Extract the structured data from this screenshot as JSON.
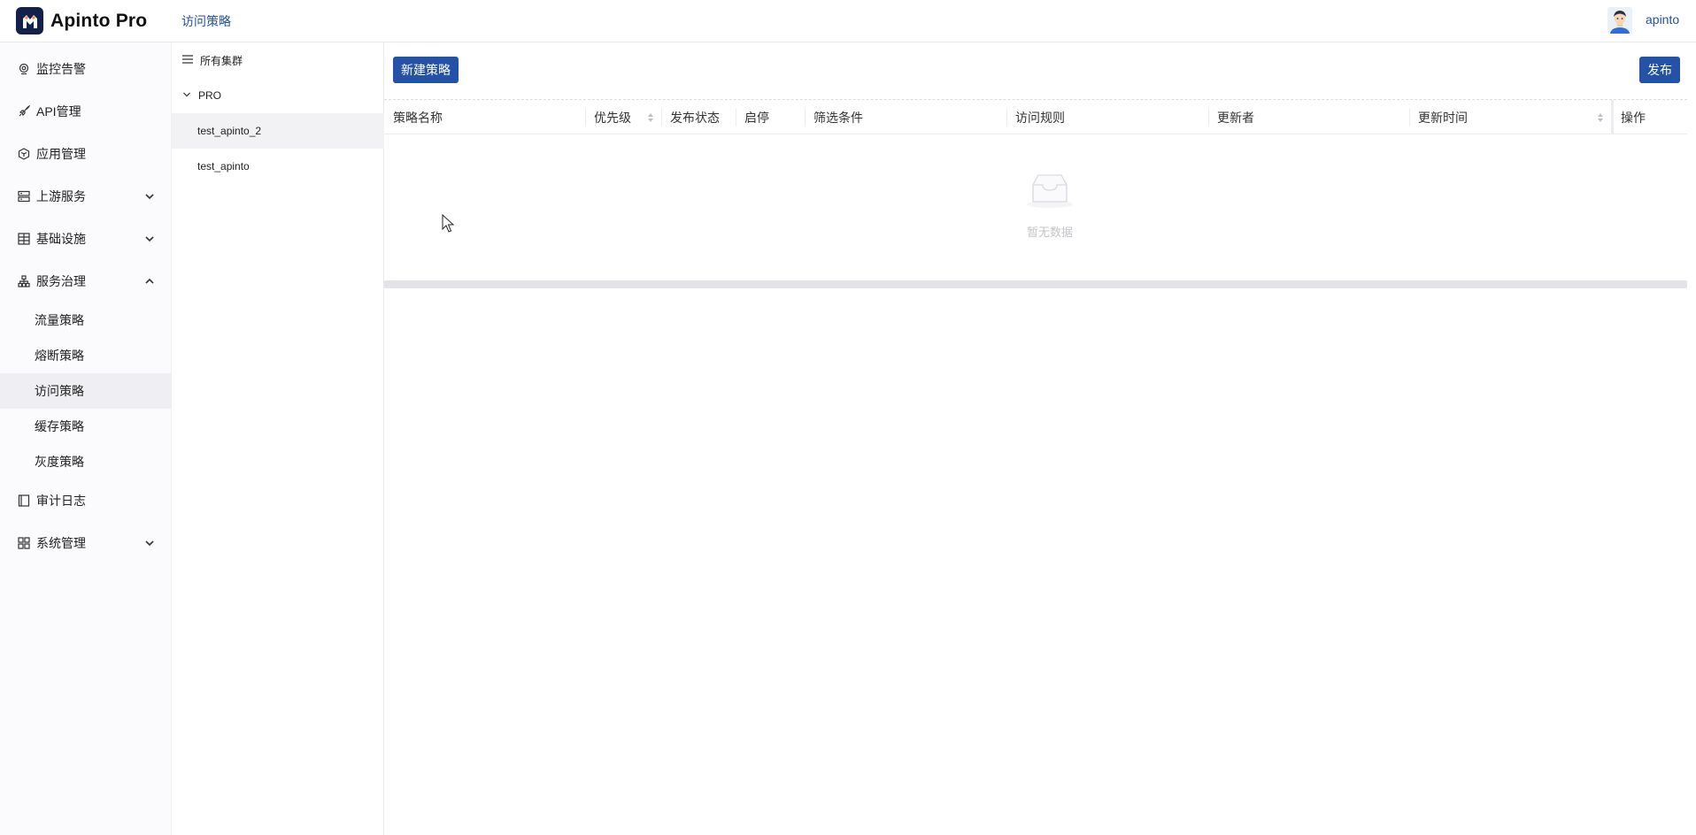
{
  "app": {
    "name": "Apinto Pro",
    "breadcrumb": "访问策略",
    "username": "apinto"
  },
  "colors": {
    "primary": "#2352a6",
    "logo_bg": "#13214a"
  },
  "sidebar": {
    "items": [
      {
        "label": "监控告警",
        "icon": "camera-icon"
      },
      {
        "label": "API管理",
        "icon": "rocket-icon"
      },
      {
        "label": "应用管理",
        "icon": "cube-icon"
      },
      {
        "label": "上游服务",
        "icon": "server-icon",
        "chevron": "down"
      },
      {
        "label": "基础设施",
        "icon": "grid-icon",
        "chevron": "down"
      },
      {
        "label": "服务治理",
        "icon": "sitemap-icon",
        "chevron": "up"
      },
      {
        "label": "审计日志",
        "icon": "book-icon"
      },
      {
        "label": "系统管理",
        "icon": "apps-icon",
        "chevron": "down"
      }
    ],
    "subitems": [
      {
        "label": "流量策略"
      },
      {
        "label": "熔断策略"
      },
      {
        "label": "访问策略",
        "active": true
      },
      {
        "label": "缓存策略"
      },
      {
        "label": "灰度策略"
      }
    ]
  },
  "clusters": {
    "header": "所有集群",
    "group": "PRO",
    "items": [
      {
        "label": "test_apinto_2",
        "active": true
      },
      {
        "label": "test_apinto"
      }
    ]
  },
  "toolbar": {
    "new_label": "新建策略",
    "publish_label": "发布"
  },
  "table": {
    "columns": [
      {
        "label": "策略名称"
      },
      {
        "label": "优先级",
        "sortable": true
      },
      {
        "label": "发布状态"
      },
      {
        "label": "启停"
      },
      {
        "label": "筛选条件"
      },
      {
        "label": "访问规则"
      },
      {
        "label": "更新者"
      },
      {
        "label": "更新时间",
        "sortable": true
      },
      {
        "label": "操作"
      }
    ],
    "empty_text": "暂无数据"
  }
}
